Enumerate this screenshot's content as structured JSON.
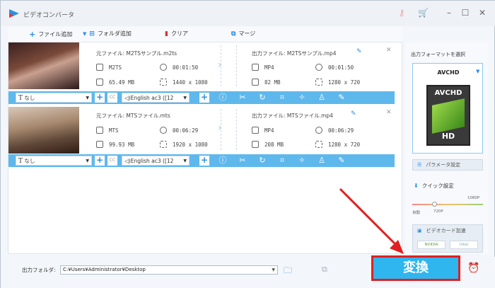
{
  "app": {
    "title": "ビデオコンバータ"
  },
  "toolbar": {
    "add_file": "ファイル追加",
    "add_folder": "フォルダ追加",
    "clear": "クリア",
    "merge": "マージ"
  },
  "files": [
    {
      "src_name": "元ファイル: M2TSサンプル.m2ts",
      "src_format": "M2TS",
      "src_duration": "00:01:50",
      "src_size": "65.49 MB",
      "src_res": "1440 x 1080",
      "out_name": "出力ファイル: M2TSサンプル.mp4",
      "out_format": "MP4",
      "out_duration": "00:01:50",
      "out_size": "82 MB",
      "out_res": "1280 x 720",
      "subtitle": "なし",
      "audio": "English ac3 ([12"
    },
    {
      "src_name": "元ファイル: MTSファイル.mts",
      "src_format": "MTS",
      "src_duration": "00:06:29",
      "src_size": "99.93 MB",
      "src_res": "1920 x 1080",
      "out_name": "出力ファイル: MTSファイル.mp4",
      "out_format": "MP4",
      "out_duration": "00:06:29",
      "out_size": "208 MB",
      "out_res": "1280 x 720",
      "subtitle": "なし",
      "audio": "English ac3 ([12"
    }
  ],
  "right_panel": {
    "format_label": "出力フォーマットを選択",
    "format_value": "AVCHD",
    "format_icon_text": "AVCHD",
    "format_icon_hd": "HD",
    "param_button": "パラメータ設定",
    "quick_label": "クイック設定",
    "quick_top": "1080P",
    "quick_left": "自動",
    "quick_bottom": "720P",
    "gpu_label": "ビデオカード加速",
    "gpu_nvidia": "NVIDIA",
    "gpu_intel": "Intel"
  },
  "bottom": {
    "output_label": "出力フォルダ:",
    "output_path": "C:¥Users¥Administrator¥Desktop",
    "convert_label": "変換"
  },
  "colors": {
    "accent": "#2fb6ee",
    "bar": "#5fb8ec",
    "highlight": "#e02020",
    "panel_border": "#8cc8f0"
  }
}
